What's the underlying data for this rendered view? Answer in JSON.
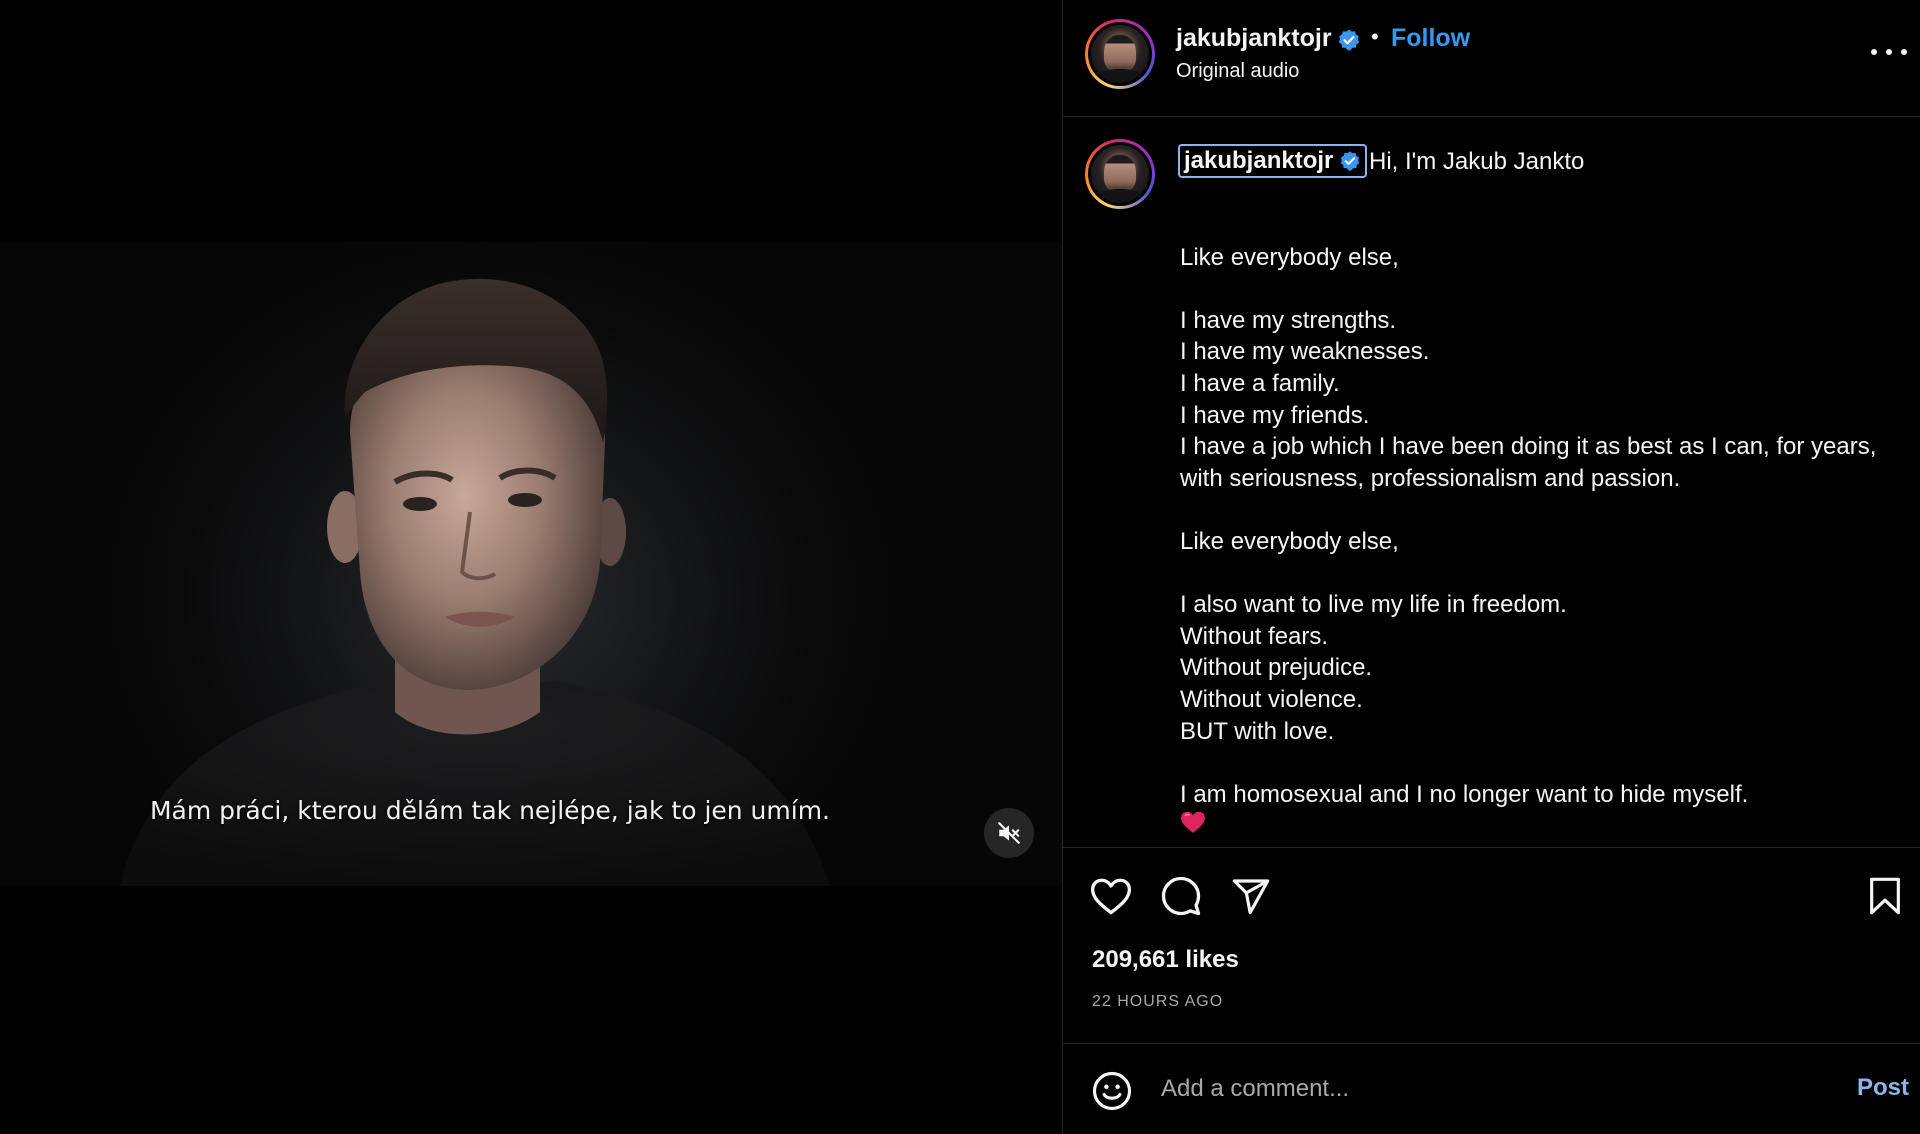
{
  "colors": {
    "background": "#000000",
    "text": "#f5f5f5",
    "muted_text": "#a8a8a8",
    "follow_blue": "#3897f0",
    "post_blue": "#8ab6e8",
    "verified_blue": "#3897f0",
    "divider": "#262626"
  },
  "video": {
    "subtitle": "Mám práci, kterou dělám tak nejlépe, jak to jen umím.",
    "mute_icon": "speaker-muted-icon"
  },
  "header": {
    "username": "jakubjanktojr",
    "separator": "•",
    "follow_label": "Follow",
    "audio_label": "Original audio",
    "more_icon": "more-options-icon"
  },
  "caption": {
    "username": "jakubjanktojr",
    "first_line": "Hi, I'm Jakub Jankto",
    "lines": [
      "",
      "Like everybody else,",
      "",
      "I have my strengths.",
      "I have my weaknesses.",
      "I have a family.",
      "I have my friends.",
      "I have a job which I have been doing it as best as I can, for years, with seriousness, professionalism and passion.",
      "",
      "Like everybody else,",
      "",
      "I also want to live my life in freedom.",
      "Without fears.",
      "Without prejudice.",
      "Without violence.",
      "BUT with love.",
      "",
      "I am homosexual and I no longer want to hide myself.",
      ""
    ],
    "emoji": "red-heart"
  },
  "actions": {
    "icons": [
      "heart-icon",
      "comment-icon",
      "share-icon",
      "bookmark-icon"
    ],
    "likes": "209,661 likes",
    "time": "22 HOURS AGO"
  },
  "comment": {
    "emoji_icon": "smiley-icon",
    "placeholder": "Add a comment...",
    "post_label": "Post"
  }
}
